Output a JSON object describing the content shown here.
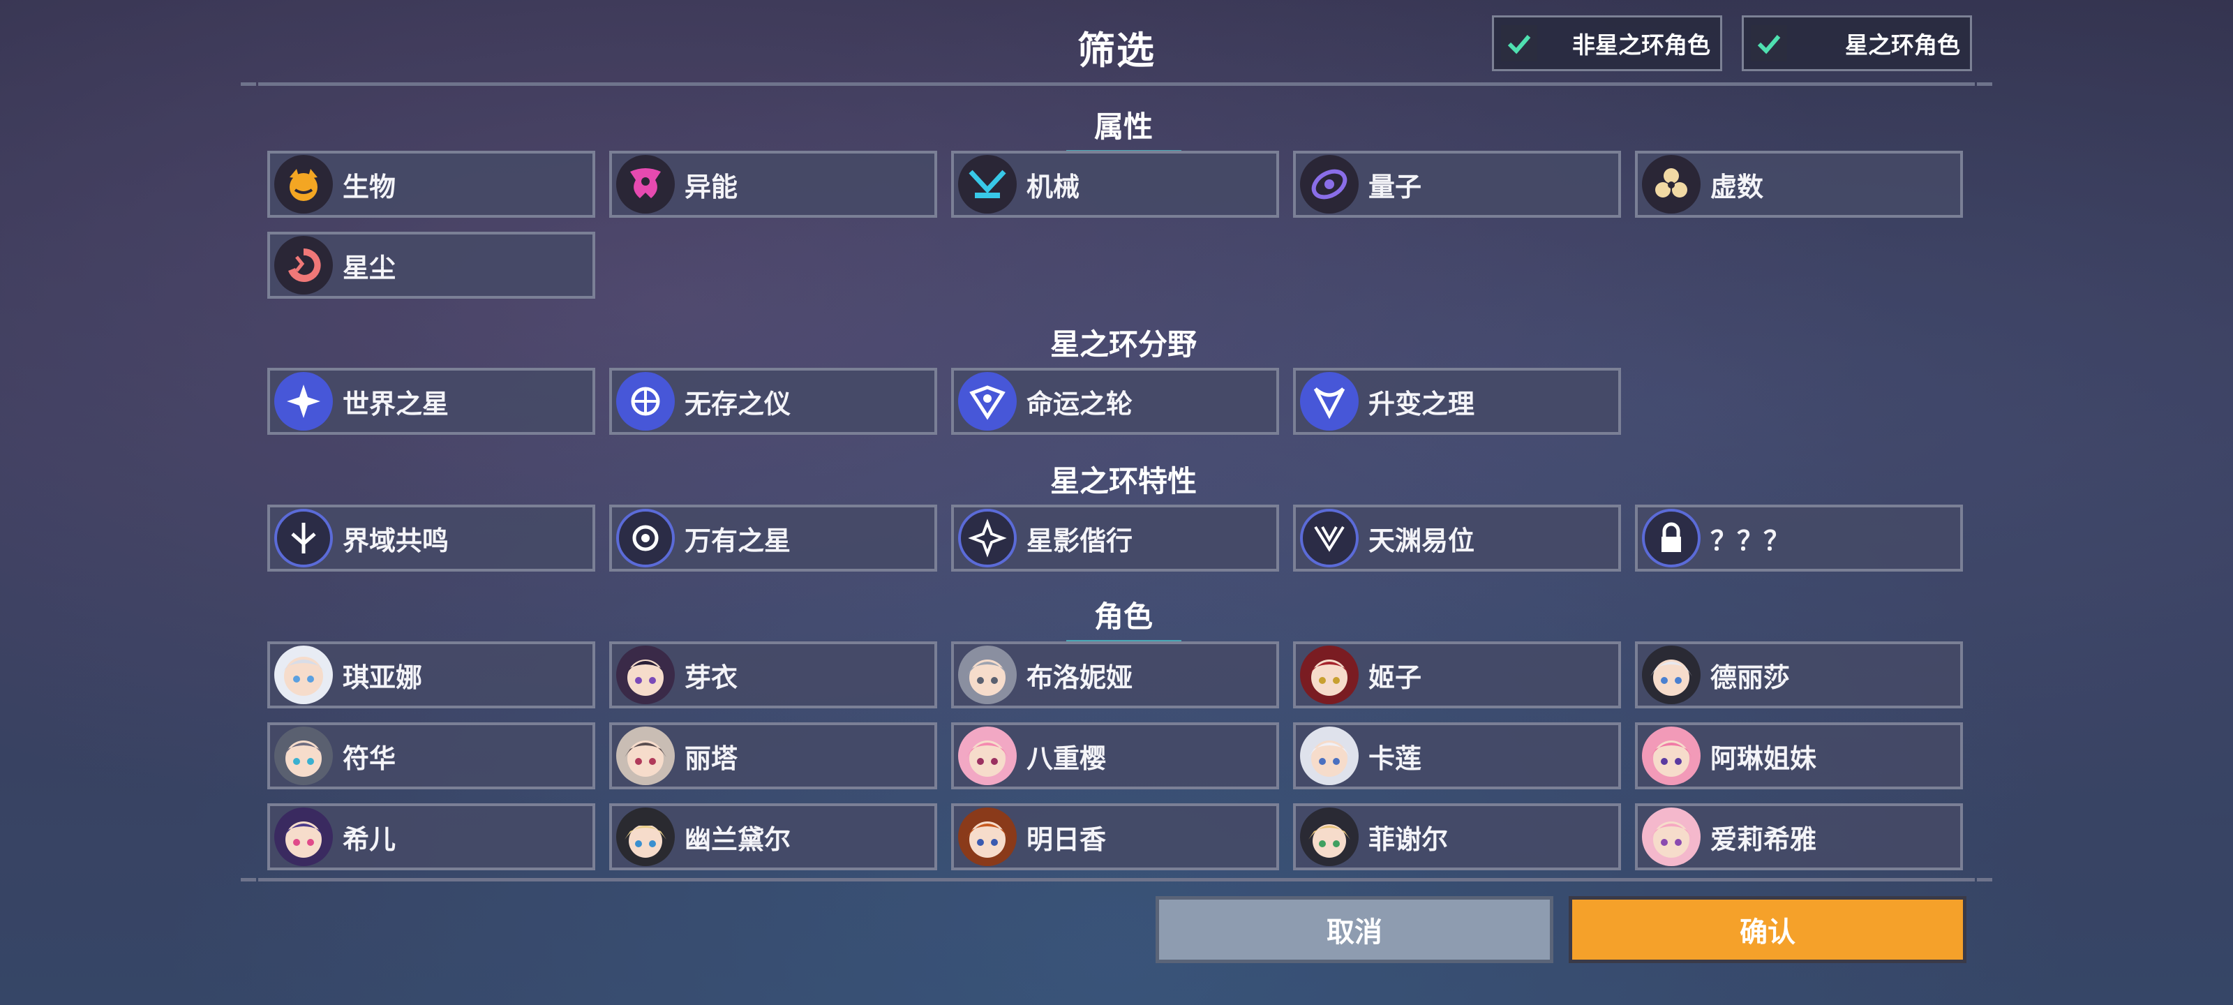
{
  "header": {
    "title": "筛选",
    "toggle_non_ring": "非星之环角色",
    "toggle_ring": "星之环角色"
  },
  "sections": {
    "attribute": "属性",
    "ring_field": "星之环分野",
    "ring_trait": "星之环特性",
    "character": "角色"
  },
  "attributes": [
    "生物",
    "异能",
    "机械",
    "量子",
    "虚数",
    "星尘"
  ],
  "ring_fields": [
    "世界之星",
    "无存之仪",
    "命运之轮",
    "升变之理"
  ],
  "ring_traits": [
    "界域共鸣",
    "万有之星",
    "星影偕行",
    "天渊易位",
    "？？？"
  ],
  "characters": [
    "琪亚娜",
    "芽衣",
    "布洛妮娅",
    "姬子",
    "德丽莎",
    "符华",
    "丽塔",
    "八重樱",
    "卡莲",
    "阿琳姐妹",
    "希儿",
    "幽兰黛尔",
    "明日香",
    "菲谢尔",
    "爱莉希雅"
  ],
  "buttons": {
    "cancel": "取消",
    "confirm": "确认"
  },
  "colors": {
    "accent_confirm": "#f5a12a",
    "check": "#4fe0b0",
    "section_underline": "#4aa7b5"
  }
}
